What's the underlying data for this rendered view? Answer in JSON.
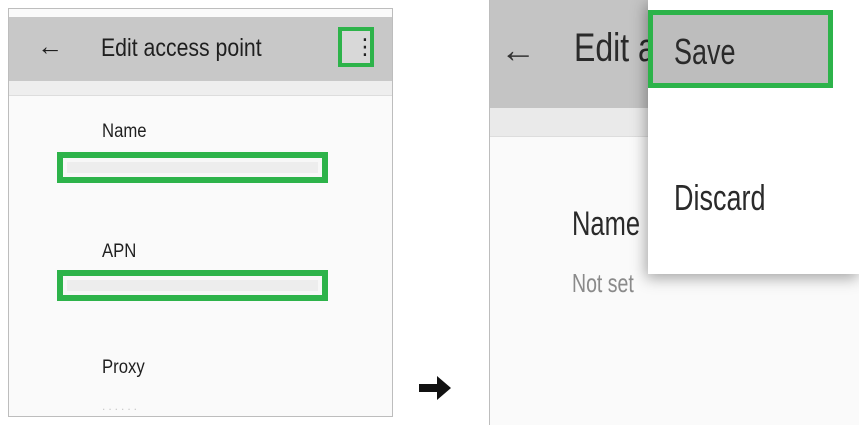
{
  "before": {
    "toolbar": {
      "back_icon": "arrow-back-icon",
      "title": "Edit access point",
      "menu_icon": "more-vert-icon"
    },
    "fields": [
      {
        "label": "Name",
        "value": ""
      },
      {
        "label": "APN",
        "value": ""
      },
      {
        "label": "Proxy"
      }
    ]
  },
  "transition_icon": "right-arrow-icon",
  "after": {
    "toolbar": {
      "back_icon": "arrow-back-icon",
      "title": "Edit a"
    },
    "field": {
      "label": "Name",
      "value": "Not set"
    },
    "overflow_menu": {
      "items": [
        "Save",
        "Discard"
      ],
      "highlighted": "Save"
    }
  },
  "colors": {
    "highlight_border": "#2db34a",
    "toolbar_bg": "#c8c8c8",
    "menu_bg": "#ffffff",
    "faint_header_text": "#e57373"
  }
}
